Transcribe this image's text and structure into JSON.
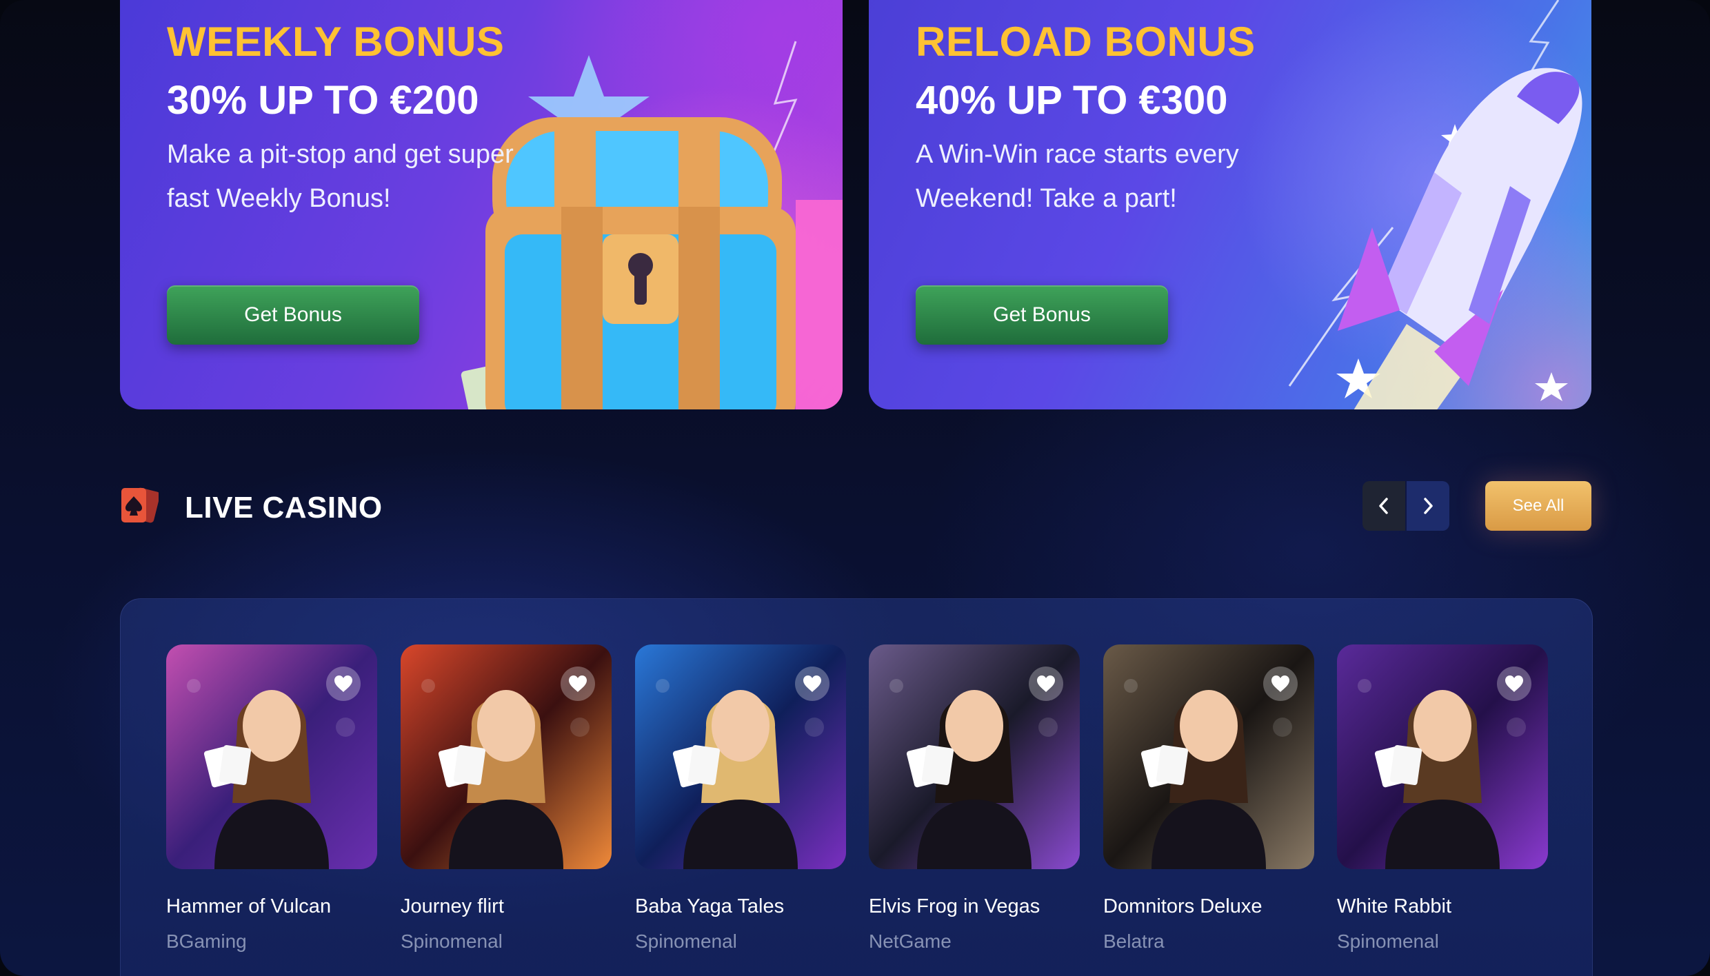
{
  "promos": [
    {
      "title": "WEEKLY BONUS",
      "amount": "30% UP TO €200",
      "description": "Make a pit-stop and get super fast Weekly Bonus!",
      "button_label": "Get Bonus",
      "art_icon": "treasure-chest-icon"
    },
    {
      "title": "RELOAD BONUS",
      "amount": "40% UP TO €300",
      "description": "A Win-Win race starts every Weekend! Take a part!",
      "button_label": "Get Bonus",
      "art_icon": "rocket-icon"
    }
  ],
  "live_casino": {
    "title": "LIVE CASINO",
    "icon": "playing-cards-icon",
    "see_all_label": "See All",
    "prev_icon": "chevron-left-icon",
    "next_icon": "chevron-right-icon",
    "games": [
      {
        "name": "Hammer of Vulcan",
        "provider": "BGaming"
      },
      {
        "name": "Journey flirt",
        "provider": "Spinomenal"
      },
      {
        "name": "Baba Yaga Tales",
        "provider": "Spinomenal"
      },
      {
        "name": "Elvis Frog in Vegas",
        "provider": "NetGame"
      },
      {
        "name": "Domnitors Deluxe",
        "provider": "Belatra"
      },
      {
        "name": "White Rabbit",
        "provider": "Spinomenal"
      }
    ]
  },
  "colors": {
    "promo_title": "#ffc233",
    "bonus_button": "#2f8a4b",
    "see_all_button": "#e8ae58",
    "section_icon": "#e8553a",
    "provider_text": "#8792b4"
  }
}
